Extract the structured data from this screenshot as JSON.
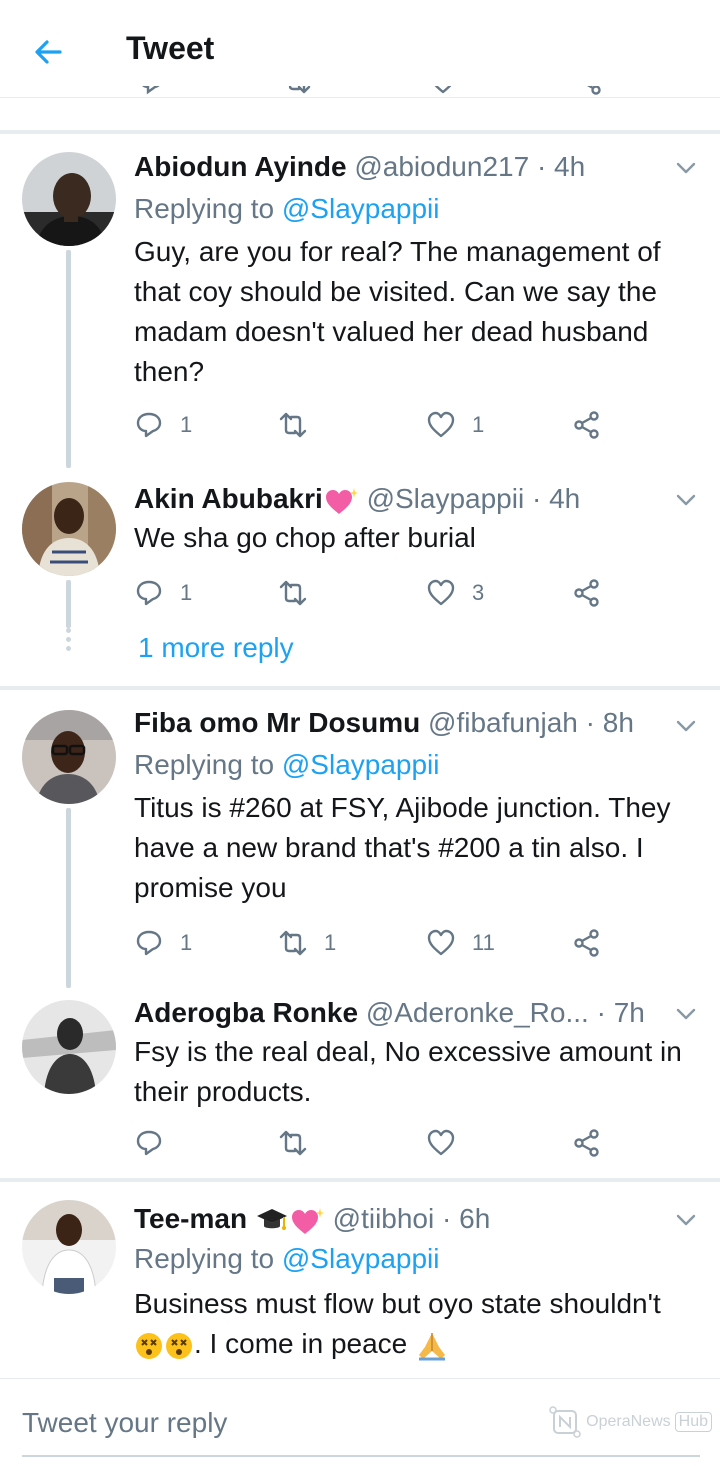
{
  "header": {
    "title": "Tweet"
  },
  "tweets": [
    {
      "name": "Abiodun Ayinde",
      "handle": "@abiodun217",
      "time": "· 4h",
      "replying_prefix": "Replying to",
      "replying_to": "@Slaypappii",
      "text": "Guy, are you for real? The management of that coy should be visited. Can we say the madam doesn't valued her dead husband then?",
      "reply_count": "1",
      "retweet_count": "",
      "like_count": "1",
      "avatar_icon": "person-photo"
    },
    {
      "name": "Akin Abubakri",
      "handle": "@Slaypappii",
      "time": "· 4h",
      "text": "We sha go chop after burial",
      "reply_count": "1",
      "retweet_count": "",
      "like_count": "3",
      "name_emoji": "sparkling-heart-icon"
    },
    {
      "name": "Fiba omo Mr Dosumu",
      "handle": "@fibafunjah",
      "time": "· 8h",
      "replying_prefix": "Replying to",
      "replying_to": "@Slaypappii",
      "text": "Titus is #260 at FSY, Ajibode junction. They have a new brand that's #200 a tin also. I promise you",
      "reply_count": "1",
      "retweet_count": "1",
      "like_count": "11"
    },
    {
      "name": "Aderogba Ronke",
      "handle": "@Aderonke_Ro...",
      "time": "· 7h",
      "text": "Fsy is the real deal, No excessive amount in their products.",
      "reply_count": "",
      "retweet_count": "",
      "like_count": ""
    },
    {
      "name": "Tee-man",
      "handle": "@tiibhoi",
      "time": "· 6h",
      "replying_prefix": "Replying to",
      "replying_to": "@Slaypappii",
      "text_part1": "Business must flow but oyo state shouldn't",
      "text_part2": ". I come in peace",
      "name_emoji": [
        "graduation-cap-icon",
        "sparkling-heart-icon"
      ],
      "text_emoji": [
        "dizzy-face-icon",
        "dizzy-face-icon",
        "folded-hands-icon"
      ]
    }
  ],
  "more_reply": "1 more reply",
  "compose": {
    "placeholder": "Tweet your reply"
  },
  "watermark": {
    "text": "OperaNews",
    "hub": "Hub"
  },
  "colors": {
    "accent": "#1da1f2",
    "secondary_text": "#657786",
    "divider": "#e6ecf0"
  }
}
